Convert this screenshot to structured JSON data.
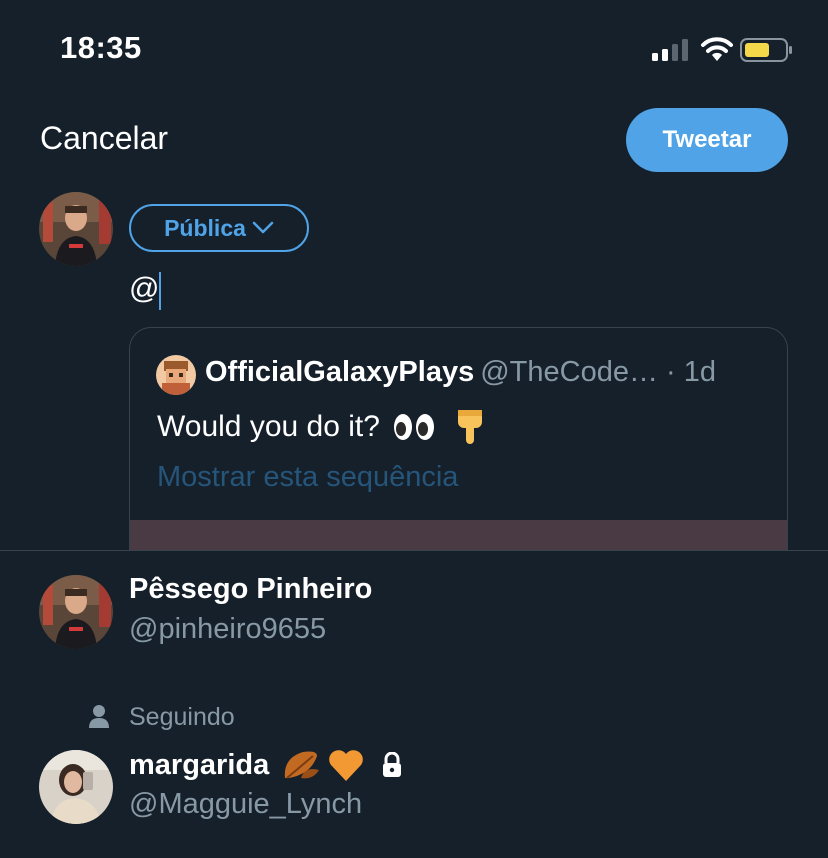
{
  "status_bar": {
    "time": "18:35"
  },
  "header": {
    "cancel_label": "Cancelar",
    "tweet_label": "Tweetar"
  },
  "composer": {
    "audience_label": "Pública",
    "text": "@"
  },
  "quote": {
    "author_name": "OfficialGalaxyPlays",
    "author_meta": "@TheCode… · 1d",
    "text": "Would you do it?",
    "show_thread_label": "Mostrar esta sequência"
  },
  "suggestions": {
    "first": {
      "name": "Pêssego Pinheiro",
      "handle": "@pinheiro9655"
    },
    "following_label": "Seguindo",
    "second": {
      "name": "margarida",
      "handle": "@Magguie_Lynch"
    }
  },
  "colors": {
    "background": "#15202b",
    "accent": "#4fa3e6",
    "secondary_text": "#8899a6"
  }
}
